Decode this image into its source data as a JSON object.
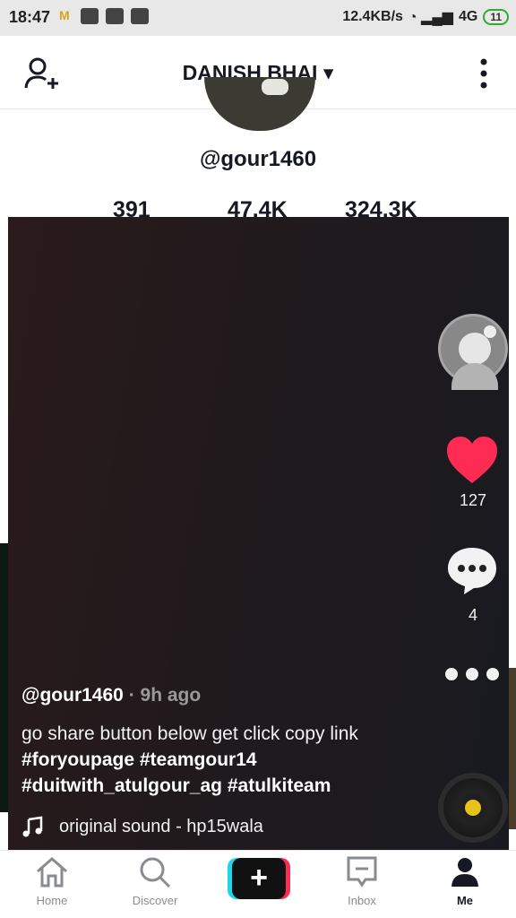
{
  "status_bar": {
    "time": "18:47",
    "network_speed": "12.4KB/s",
    "network_type": "4G",
    "battery": "11"
  },
  "header": {
    "title": "DANISH BHAI",
    "title_caret": "▾"
  },
  "profile": {
    "handle": "@gour1460",
    "stats": [
      "391",
      "47.4K",
      "324.3K"
    ]
  },
  "video": {
    "like_count": "127",
    "comment_count": "4",
    "author": "@gour1460",
    "time_ago": "· 9h ago",
    "caption_text": "go share button below get click copy link ",
    "caption_tags": "#foryoupage #teamgour14 #duitwith_atulgour_ag #atulkiteam",
    "sound": "original sound - hp15wala",
    "colors": {
      "like": "#fe2c55",
      "disc_core": "#e8c11a"
    }
  },
  "bottom_nav": {
    "home": "Home",
    "discover": "Discover",
    "create": "+",
    "inbox": "Inbox",
    "me": "Me"
  }
}
